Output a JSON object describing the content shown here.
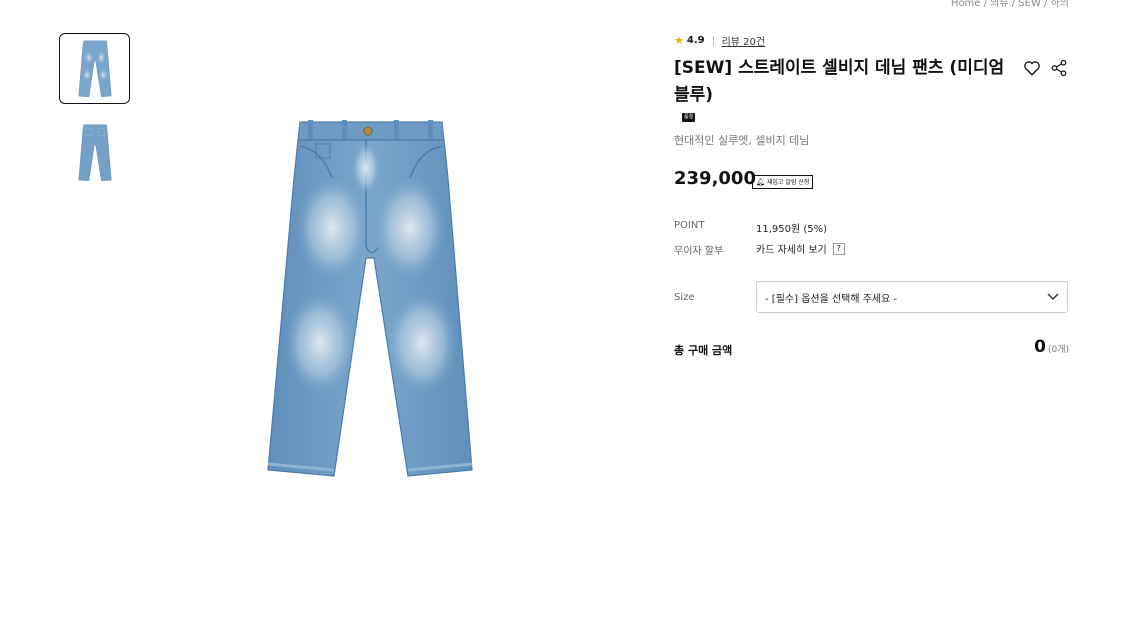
{
  "breadcrumb": "Home / 의류 / SEW / 하의",
  "gallery": {
    "thumbnails": [
      {
        "alt": "denim-pants-front",
        "active": true
      },
      {
        "alt": "denim-pants-back",
        "active": false
      }
    ]
  },
  "product": {
    "rating": "4.9",
    "review_link": "리뷰 20건",
    "title": "[SEW] 스트레이트 셀비지 데님 팬츠 (미디엄 블루)",
    "badge": "품절",
    "subtitle": "현대적인 실루엣, 셀비지 데님",
    "price": "239,000",
    "restock_button": "재입고 알림 신청",
    "point_label": "POINT",
    "point_value": "11,950원 (5%)",
    "installment_label": "무이자 할부",
    "installment_value": "카드 자세히 보기",
    "help_label": "?",
    "size_label": "Size",
    "size_select": "- [필수] 옵션을 선택해 주세요 -",
    "total_label": "총 구매 금액",
    "total_amount": "0",
    "total_count": "(0개)"
  },
  "colors": {
    "star": "#f5b400",
    "denim_light": "#a9c6de",
    "denim": "#6f9ec6",
    "denim_dark": "#4a7cab"
  },
  "icons": [
    "star-icon",
    "heart-icon",
    "share-icon",
    "bell-icon",
    "chevron-down-icon"
  ]
}
